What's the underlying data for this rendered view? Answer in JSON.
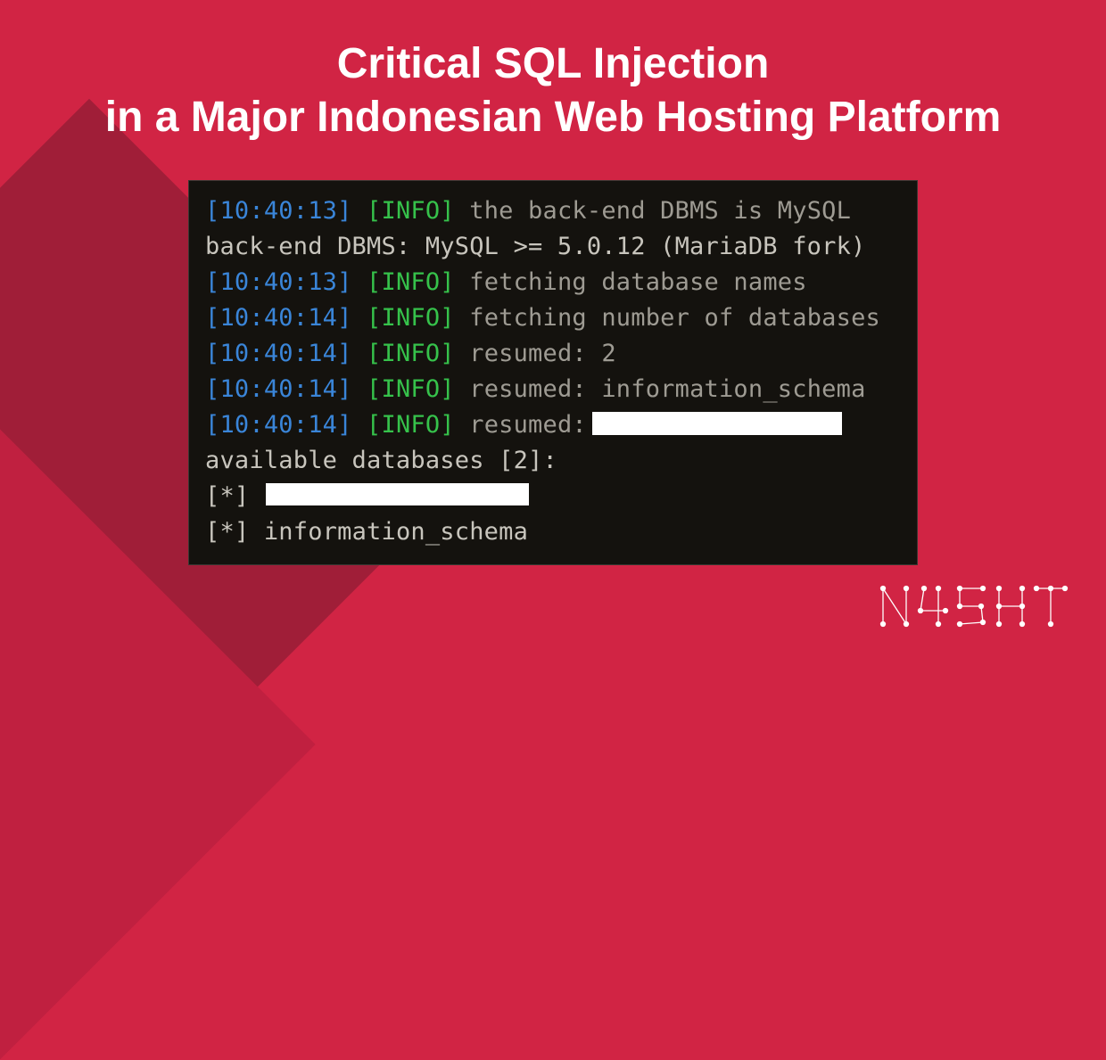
{
  "title": {
    "line1": "Critical SQL Injection",
    "line2": "in a Major Indonesian Web Hosting Platform"
  },
  "terminal": {
    "lines": [
      {
        "ts": "[10:40:13]",
        "tag": "[INFO]",
        "msg": "the back-end DBMS is MySQL"
      },
      {
        "plain": "back-end DBMS: MySQL >= 5.0.12 (MariaDB fork)"
      },
      {
        "ts": "[10:40:13]",
        "tag": "[INFO]",
        "msg": "fetching database names"
      },
      {
        "ts": "[10:40:14]",
        "tag": "[INFO]",
        "msg": "fetching number of databases"
      },
      {
        "ts": "[10:40:14]",
        "tag": "[INFO]",
        "msg": "resumed: 2"
      },
      {
        "ts": "[10:40:14]",
        "tag": "[INFO]",
        "msg": "resumed: information_schema"
      },
      {
        "ts": "[10:40:14]",
        "tag": "[INFO]",
        "msg": "resumed:",
        "redacted": true
      },
      {
        "plain": "available databases [2]:"
      },
      {
        "bullet": "[*]",
        "redacted": true
      },
      {
        "bullet": "[*]",
        "value": "information_schema"
      }
    ]
  },
  "logo": {
    "text": "N45HT"
  }
}
